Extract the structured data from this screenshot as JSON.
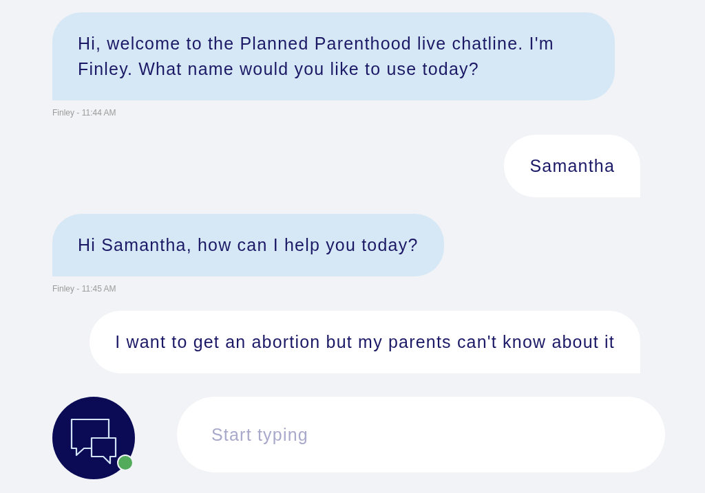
{
  "messages": [
    {
      "kind": "agent",
      "text": "Hi, welcome to the Planned Parenthood live chatline. I'm Finley. What name would you like to use today?",
      "meta": "Finley - 11:44 AM"
    },
    {
      "kind": "user",
      "text": "Samantha"
    },
    {
      "kind": "agent",
      "text": "Hi Samantha, how can I help you today?",
      "meta": "Finley - 11:45 AM"
    },
    {
      "kind": "user",
      "text": "I want to get an abortion but my parents can't know about it"
    }
  ],
  "agent_status": {
    "online": true
  },
  "composer": {
    "placeholder": "Start typing"
  }
}
